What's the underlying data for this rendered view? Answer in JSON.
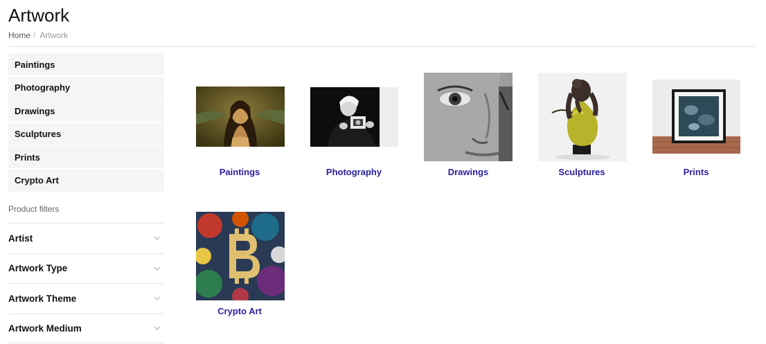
{
  "page": {
    "title": "Artwork"
  },
  "breadcrumb": {
    "home": "Home",
    "separator": "/",
    "current": "Artwork"
  },
  "sidebar": {
    "categories": [
      "Paintings",
      "Photography",
      "Drawings",
      "Sculptures",
      "Prints",
      "Crypto Art"
    ],
    "filters_label": "Product filters",
    "filters": [
      "Artist",
      "Artwork Type",
      "Artwork Theme",
      "Artwork Medium"
    ]
  },
  "products": [
    {
      "label": "Paintings",
      "image": "mona-lisa-painting"
    },
    {
      "label": "Photography",
      "image": "bw-portrait-with-camera"
    },
    {
      "label": "Drawings",
      "image": "pencil-drawing-of-face"
    },
    {
      "label": "Sculptures",
      "image": "gorilla-on-pear-sculpture"
    },
    {
      "label": "Prints",
      "image": "framed-print"
    },
    {
      "label": "Crypto Art",
      "image": "bitcoin-painting"
    }
  ],
  "colors": {
    "link": "#2a1f9e",
    "sidebar_bg": "#f5f5f5"
  }
}
